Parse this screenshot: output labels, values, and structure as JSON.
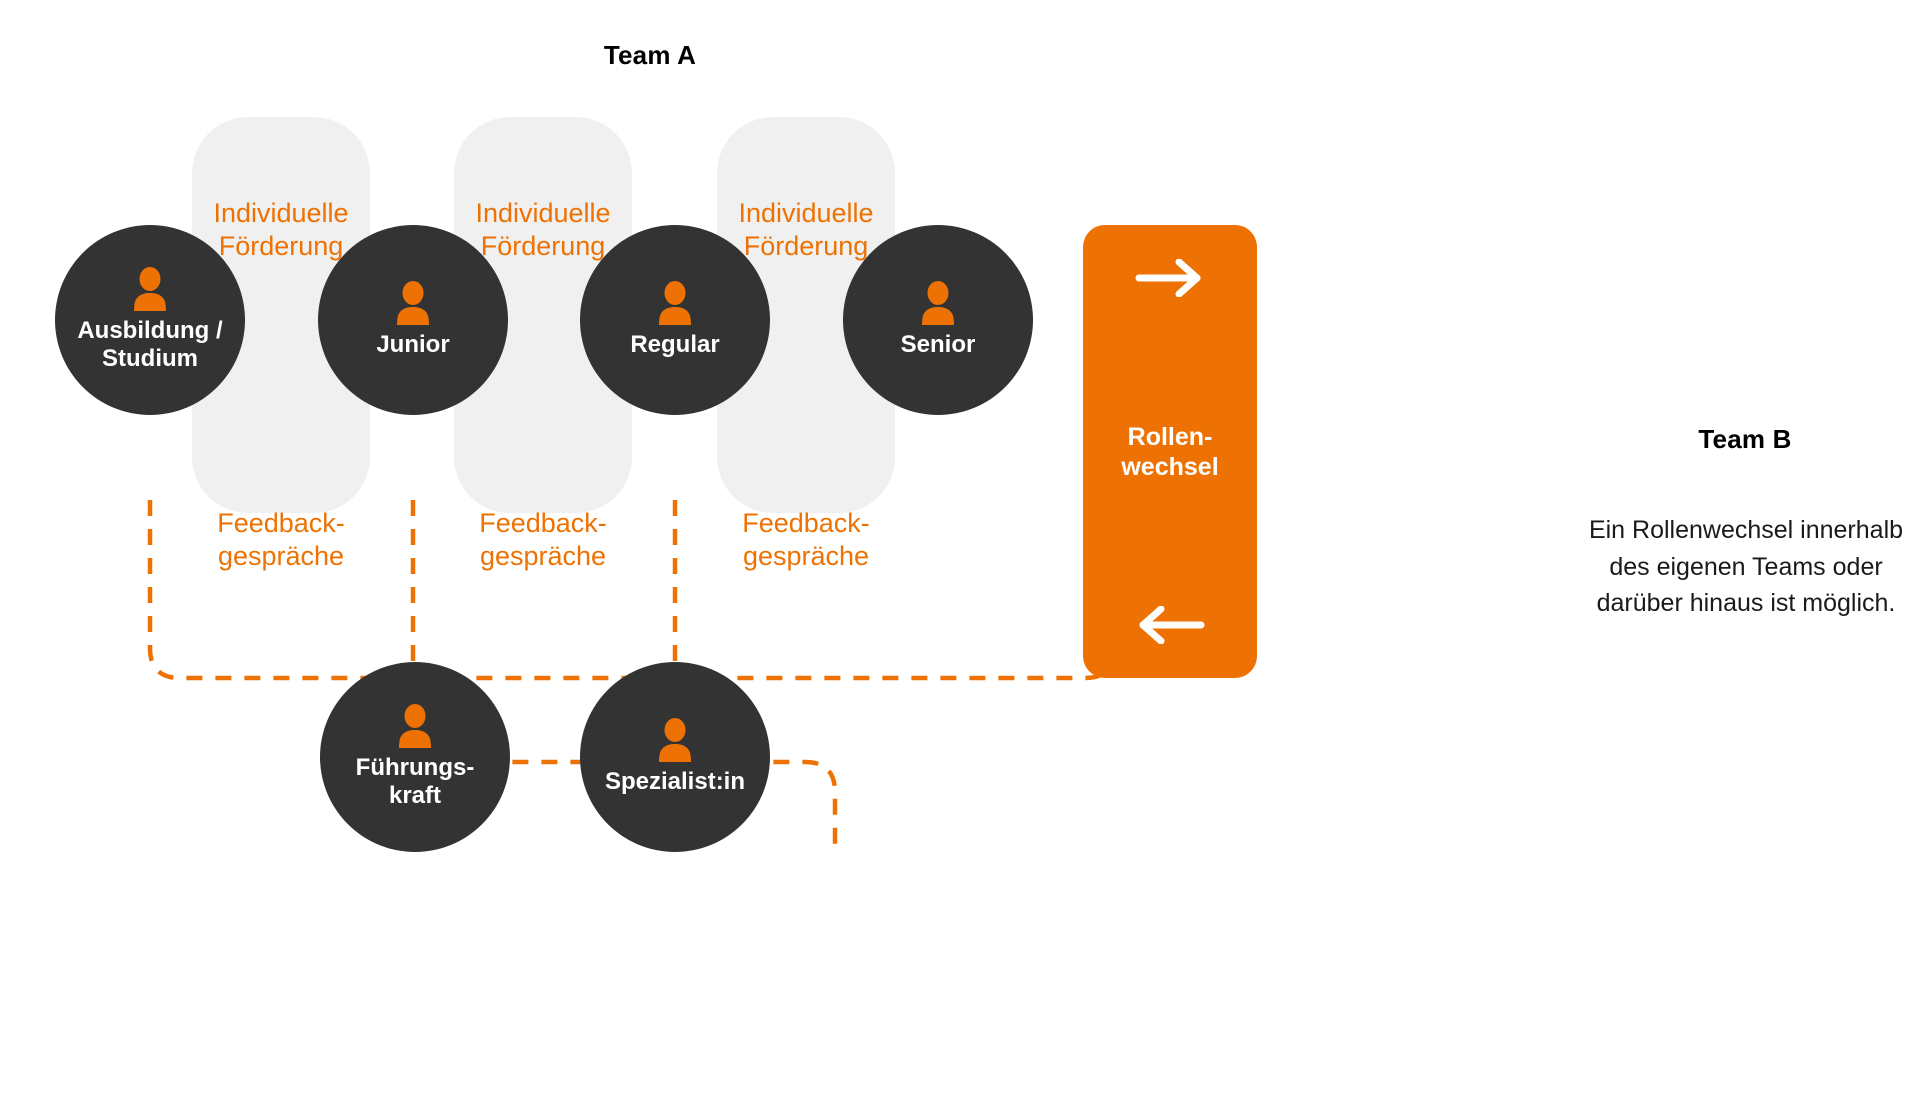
{
  "colors": {
    "orange": "#EE7203",
    "dark": "#333333",
    "panel_gray": "#F0F0F0",
    "white": "#FFFFFF",
    "black": "#000000"
  },
  "team_a": {
    "title": "Team A",
    "nodes": [
      {
        "label": "Ausbildung /\nStudium",
        "icon": "person-icon"
      },
      {
        "label": "Junior",
        "icon": "person-icon"
      },
      {
        "label": "Regular",
        "icon": "person-icon"
      },
      {
        "label": "Senior",
        "icon": "person-icon"
      }
    ],
    "chevrons": [
      {
        "icon": "chevron-right-icon"
      },
      {
        "icon": "chevron-right-icon"
      },
      {
        "icon": "chevron-right-icon"
      }
    ],
    "panels": [
      {
        "top_label": "Individuelle\nFörderung",
        "bottom_label": "Feedback-\ngespräche"
      },
      {
        "top_label": "Individuelle\nFörderung",
        "bottom_label": "Feedback-\ngespräche"
      },
      {
        "top_label": "Individuelle\nFörderung",
        "bottom_label": "Feedback-\ngespräche"
      }
    ],
    "branch_nodes": [
      {
        "label": "Führungs-\nkraft",
        "icon": "person-icon"
      },
      {
        "label": "Spezialist:in",
        "icon": "person-icon"
      }
    ]
  },
  "role_switch": {
    "label": "Rollen-\nwechsel",
    "top_icon": "arrow-right-icon",
    "bottom_icon": "arrow-left-icon"
  },
  "team_b": {
    "title": "Team B",
    "description": "Ein Rollenwechsel innerhalb des eigenen Teams oder darüber hinaus ist möglich."
  }
}
